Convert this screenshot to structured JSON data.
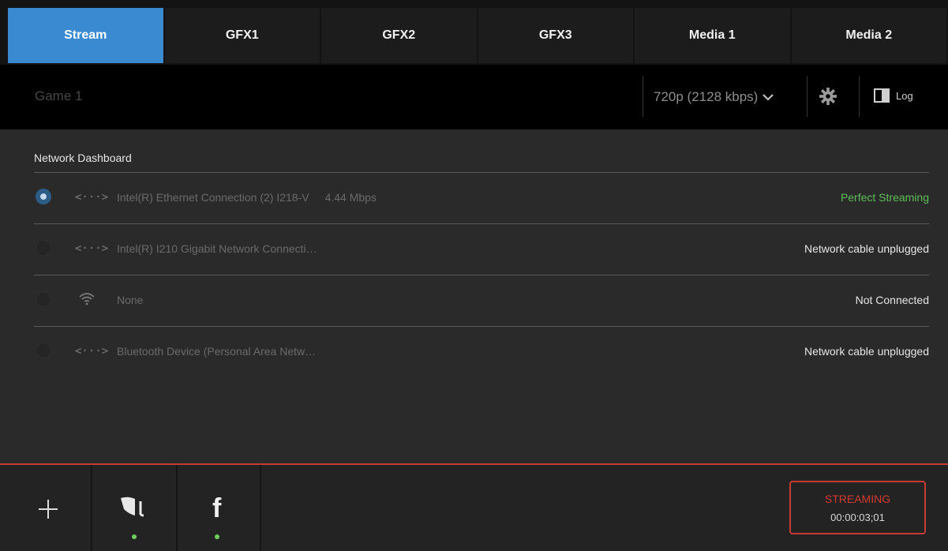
{
  "tabs": [
    {
      "label": "Stream",
      "active": true
    },
    {
      "label": "GFX1"
    },
    {
      "label": "GFX2"
    },
    {
      "label": "GFX3"
    },
    {
      "label": "Media 1"
    },
    {
      "label": "Media 2"
    }
  ],
  "toolbar": {
    "title": "Game 1",
    "quality": "720p (2128 kbps)",
    "quality_icon": "chevron-down-icon",
    "settings_icon": "gear-icon",
    "log_label": "Log",
    "log_icon": "panel-icon"
  },
  "dashboard": {
    "title": "Network Dashboard",
    "rows": [
      {
        "icon": "<···>",
        "name": "Intel(R) Ethernet Connection (2) I218-V",
        "rate": "4.44 Mbps",
        "status": "Perfect Streaming",
        "selected": true
      },
      {
        "icon": "<···>",
        "name": "Intel(R) I210 Gigabit Network Connecti…",
        "rate": "",
        "status": "Network cable unplugged",
        "selected": false
      },
      {
        "icon": "wifi",
        "name": "None",
        "rate": "",
        "status": "Not Connected",
        "selected": false
      },
      {
        "icon": "<···>",
        "name": "Bluetooth Device (Personal Area Netw…",
        "rate": "",
        "status": "Network cable unplugged",
        "selected": false
      }
    ]
  },
  "footer": {
    "add_icon": "plus-icon",
    "destinations": [
      {
        "icon": "wirecast-icon",
        "connected": true
      },
      {
        "icon": "facebook-icon",
        "letter": "f",
        "connected": true
      }
    ],
    "streaming_label": "STREAMING",
    "streaming_time": "00:00:03;01"
  },
  "colors": {
    "accent": "#3a8ad1",
    "alert": "#c43b33",
    "ok": "#5ebd56"
  }
}
